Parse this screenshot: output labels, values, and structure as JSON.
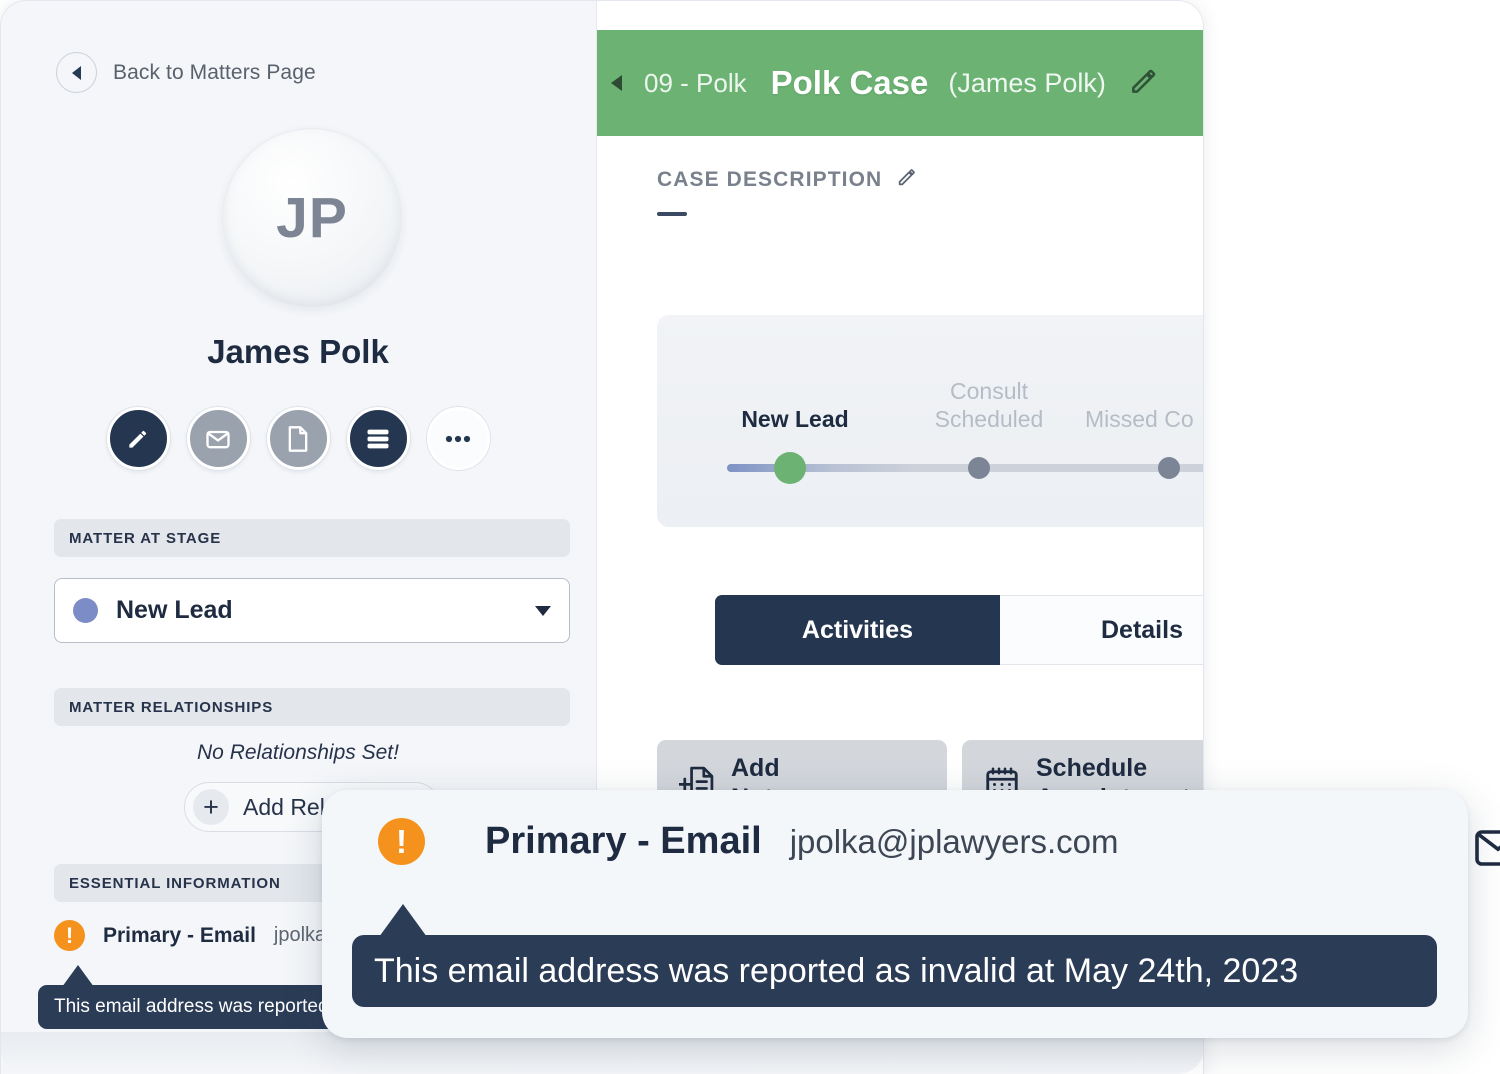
{
  "left_panel": {
    "back_link": "Back to Matters Page",
    "back_icon": "chevron-left-icon",
    "avatar_initials": "JP",
    "person_name": "James Polk",
    "action_buttons": [
      {
        "icon": "pencil-icon",
        "style": "dark"
      },
      {
        "icon": "envelope-icon",
        "style": "gray"
      },
      {
        "icon": "document-icon",
        "style": "gray"
      },
      {
        "icon": "stacked-bars-icon",
        "style": "dark"
      },
      {
        "icon": "ellipsis-icon",
        "style": "plain"
      }
    ],
    "stage_section": {
      "header": "MATTER AT STAGE",
      "selected_stage": "New Lead",
      "dot_color": "#7c8cc6",
      "caret_icon": "chevron-down-icon"
    },
    "relationships_section": {
      "header": "MATTER RELATIONSHIPS",
      "empty_message": "No Relationships Set!",
      "add_button": "Add Relationship",
      "add_icon": "plus-icon"
    },
    "essential_section": {
      "header": "ESSENTIAL INFORMATION",
      "warning_icon": "exclamation-circle-icon",
      "row_key": "Primary - Email",
      "row_value": "jpolka@jplawyers.com",
      "tooltip": "This email address was reported as invalid at May 24th, 2023"
    }
  },
  "right_panel": {
    "header": {
      "back_icon": "chevron-left-icon",
      "case_number": "09 - Polk",
      "case_title": "Polk Case",
      "client": "(James Polk)",
      "edit_icon": "pencil-icon",
      "background_color": "#6cb273"
    },
    "case_description": {
      "label": "CASE DESCRIPTION",
      "edit_icon": "pencil-icon",
      "value": "—"
    },
    "stage_tracker": {
      "stages": [
        {
          "label": "New Lead",
          "state": "current"
        },
        {
          "label": "Consult\nScheduled",
          "state": "upcoming"
        },
        {
          "label": "Missed Co",
          "state": "upcoming"
        }
      ],
      "stage_0_label": "New Lead",
      "stage_1_line1": "Consult",
      "stage_1_line2": "Scheduled",
      "stage_2_label": "Missed Co",
      "current_color": "#6cb273",
      "upcoming_color": "#7c8596"
    },
    "tabs": [
      {
        "label": "Activities",
        "active": true
      },
      {
        "label": "Details",
        "active": false
      }
    ],
    "tab_activities": "Activities",
    "tab_details": "Details",
    "quick_actions": [
      {
        "label": "Add Note",
        "icon": "add-note-icon"
      },
      {
        "label": "Schedule Appointment",
        "icon": "calendar-icon"
      }
    ],
    "quick_add_note": "Add\nNote",
    "quick_schedule": "Schedule\nAppointment"
  },
  "overlay_card": {
    "warning_icon": "exclamation-circle-icon",
    "field_label": "Primary - Email",
    "field_value": "jpolka@jplawyers.com",
    "mail_icon": "envelope-icon",
    "tooltip_text": "This email address was reported as invalid at May 24th, 2023",
    "accent_warning_color": "#f5921e",
    "tooltip_background": "#2b3c56"
  }
}
